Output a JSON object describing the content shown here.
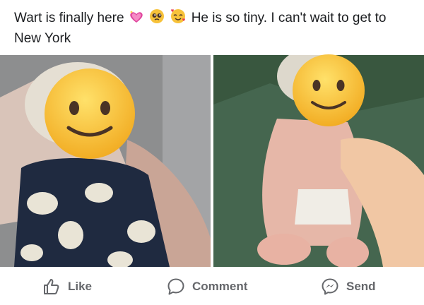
{
  "post": {
    "caption_part1": "Wart is finally here",
    "caption_part2": "He is so tiny. I can't wait to get to New York",
    "caption_emojis": [
      "sparkling-heart-icon",
      "pleading-face-icon",
      "smiling-face-with-hearts-icon"
    ]
  },
  "actions": {
    "like_label": "Like",
    "comment_label": "Comment",
    "send_label": "Send"
  },
  "colors": {
    "text": "#1c1e21",
    "action_text": "#65676b",
    "emoji_face": "#f7c23a"
  }
}
